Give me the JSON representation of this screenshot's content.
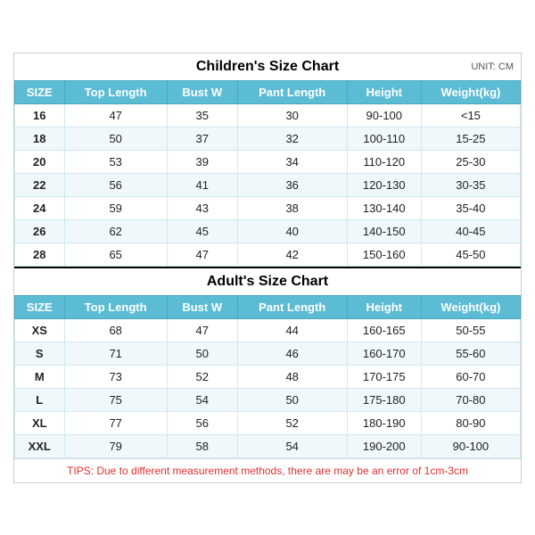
{
  "children_title": "Children's Size Chart",
  "adult_title": "Adult's Size Chart",
  "unit_label": "UNIT: CM",
  "tips": "TIPS: Due to different measurement methods, there are may be an error of 1cm-3cm",
  "headers": [
    "SIZE",
    "Top Length",
    "Bust W",
    "Pant Length",
    "Height",
    "Weight(kg)"
  ],
  "children_rows": [
    [
      "16",
      "47",
      "35",
      "30",
      "90-100",
      "<15"
    ],
    [
      "18",
      "50",
      "37",
      "32",
      "100-110",
      "15-25"
    ],
    [
      "20",
      "53",
      "39",
      "34",
      "110-120",
      "25-30"
    ],
    [
      "22",
      "56",
      "41",
      "36",
      "120-130",
      "30-35"
    ],
    [
      "24",
      "59",
      "43",
      "38",
      "130-140",
      "35-40"
    ],
    [
      "26",
      "62",
      "45",
      "40",
      "140-150",
      "40-45"
    ],
    [
      "28",
      "65",
      "47",
      "42",
      "150-160",
      "45-50"
    ]
  ],
  "adult_rows": [
    [
      "XS",
      "68",
      "47",
      "44",
      "160-165",
      "50-55"
    ],
    [
      "S",
      "71",
      "50",
      "46",
      "160-170",
      "55-60"
    ],
    [
      "M",
      "73",
      "52",
      "48",
      "170-175",
      "60-70"
    ],
    [
      "L",
      "75",
      "54",
      "50",
      "175-180",
      "70-80"
    ],
    [
      "XL",
      "77",
      "56",
      "52",
      "180-190",
      "80-90"
    ],
    [
      "XXL",
      "79",
      "58",
      "54",
      "190-200",
      "90-100"
    ]
  ]
}
